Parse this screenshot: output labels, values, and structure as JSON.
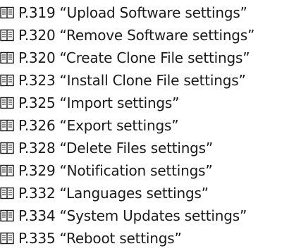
{
  "references": [
    {
      "icon": "book-icon",
      "page": "P.319",
      "title": "“Upload Software settings”"
    },
    {
      "icon": "book-icon",
      "page": "P.320",
      "title": "“Remove Software settings”"
    },
    {
      "icon": "book-icon",
      "page": "P.320",
      "title": "“Create Clone File settings”"
    },
    {
      "icon": "book-icon",
      "page": "P.323",
      "title": "“Install Clone File settings”"
    },
    {
      "icon": "book-icon",
      "page": "P.325",
      "title": "“Import settings”"
    },
    {
      "icon": "book-icon",
      "page": "P.326",
      "title": "“Export settings”"
    },
    {
      "icon": "book-icon",
      "page": "P.328",
      "title": "“Delete Files settings”"
    },
    {
      "icon": "book-icon",
      "page": "P.329",
      "title": "“Notification settings”"
    },
    {
      "icon": "book-icon",
      "page": "P.332",
      "title": "“Languages settings”"
    },
    {
      "icon": "book-icon",
      "page": "P.334",
      "title": "“System Updates settings”"
    },
    {
      "icon": "book-icon",
      "page": "P.335",
      "title": "“Reboot settings”"
    }
  ]
}
